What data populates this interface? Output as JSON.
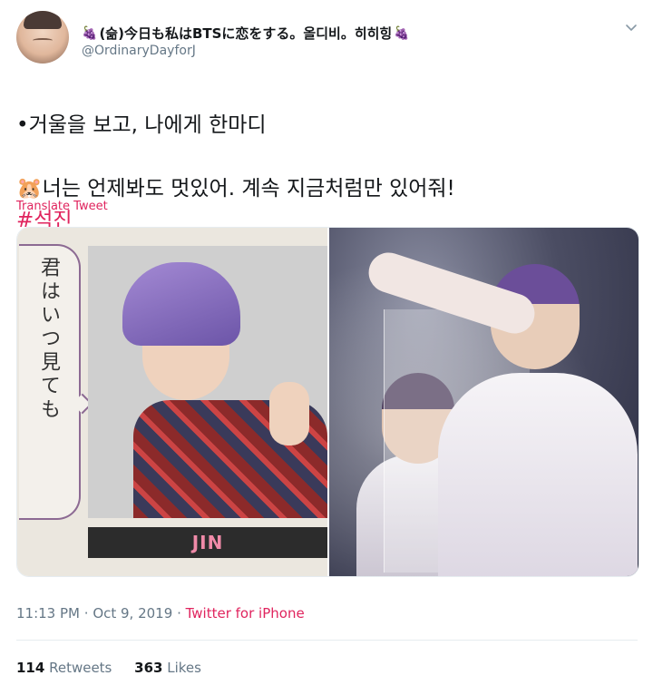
{
  "author": {
    "display_name": "(슮)今日も私はBTSに恋をする。올디비。히히힝",
    "handle": "@OrdinaryDayforJ",
    "emoji_icon": "grape-icon"
  },
  "tweet": {
    "line1": "•거울을 보고, 나에게 한마디",
    "line2_emoji": "🐹",
    "line2": "너는 언제봐도 멋있어. 계속 지금처럼만 있어줘!",
    "hashtag": "#석진",
    "translate_label": "Translate Tweet"
  },
  "media": {
    "left_caption_vertical": "君はいつ見ても",
    "left_nameplate": "JIN"
  },
  "meta": {
    "time": "11:13 PM",
    "date": "Oct 9, 2019",
    "source": "Twitter for iPhone"
  },
  "stats": {
    "retweets_count": "114",
    "retweets_label": "Retweets",
    "likes_count": "363",
    "likes_label": "Likes"
  },
  "colors": {
    "accent": "#e0245e",
    "muted": "#657786",
    "text": "#14171a"
  }
}
